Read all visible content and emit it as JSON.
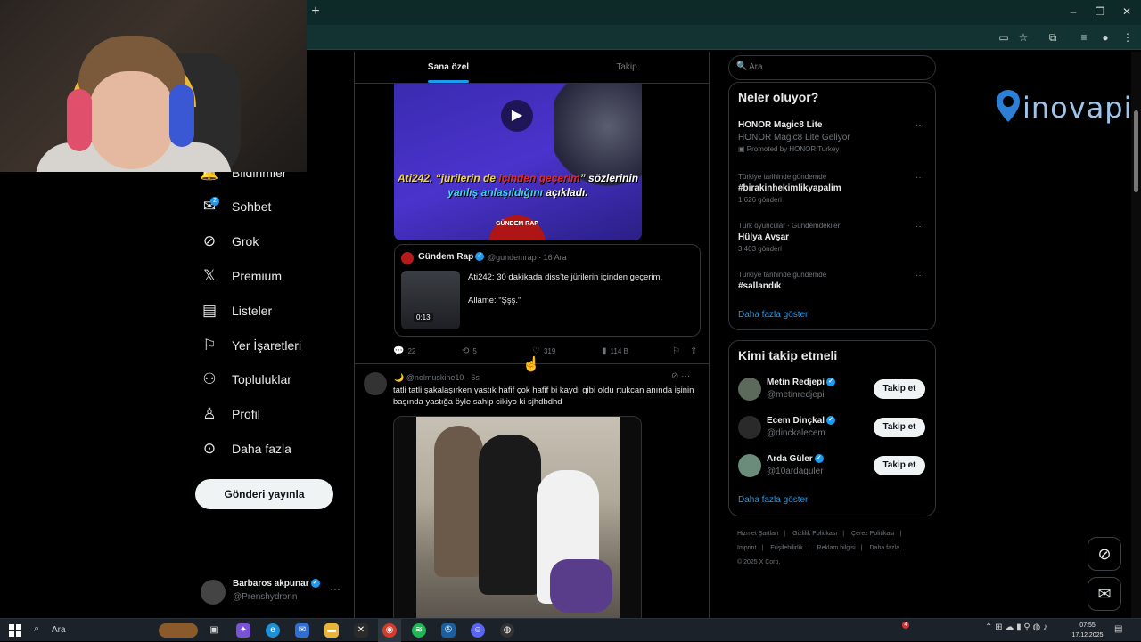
{
  "browser": {
    "new_tab_icon": "plus-icon",
    "window_controls": [
      "minimize",
      "restore",
      "close"
    ]
  },
  "nav": {
    "items": [
      {
        "label": "Bildirimler",
        "icon": "bell-icon"
      },
      {
        "label": "Sohbet",
        "icon": "chat-icon",
        "badge": "2"
      },
      {
        "label": "Grok",
        "icon": "grok-icon"
      },
      {
        "label": "Premium",
        "icon": "x-logo-icon"
      },
      {
        "label": "Listeler",
        "icon": "list-icon"
      },
      {
        "label": "Yer İşaretleri",
        "icon": "bookmark-icon"
      },
      {
        "label": "Topluluklar",
        "icon": "communities-icon"
      },
      {
        "label": "Profil",
        "icon": "profile-icon"
      },
      {
        "label": "Daha fazla",
        "icon": "more-circle-icon"
      }
    ],
    "post_button": "Gönderi yayınla",
    "account": {
      "name": "Barbaros akpunar",
      "handle": "@Prenshydronn"
    }
  },
  "feed": {
    "tabs": {
      "for_you": "Sana özel",
      "following": "Takip"
    },
    "post1": {
      "video_caption_1": "Ati242, “jürilerin de ",
      "video_caption_red": "içinden geçerim",
      "video_caption_2": "” sözlerinin",
      "video_caption_3a": "yanlış anlaşıldığını",
      "video_caption_3b": " açıkladı.",
      "video_logo": "GÜNDEM RAP",
      "quote": {
        "name": "Gündem Rap",
        "handle_date": "@gundemrap · 16 Ara",
        "text": "Ati242: 30 dakikada diss’te jürilerin içinden geçerim.",
        "text2": "Allame: “Şşş.”",
        "duration": "0:13"
      },
      "actions": {
        "replies": "22",
        "reposts": "5",
        "likes": "319",
        "views": "114 B"
      }
    },
    "post2": {
      "meta": "🌙 @nolmuskine10 · 6s",
      "text": "tatli tatli şakalaşırken yastık hafif çok hafif bi kaydı gibi oldu rtukcan anında işinin başında yastığa öyle sahip cikiyo ki sjhdbdhd"
    }
  },
  "sidebar": {
    "search_placeholder": "Ara",
    "trends": {
      "heading": "Neler oluyor?",
      "items": [
        {
          "title": "HONOR Magic8 Lite",
          "subtitle": "HONOR Magic8 Lite Geliyor",
          "count": "Promoted by HONOR Turkey"
        },
        {
          "context": "Türkiye tarihinde gündemde",
          "title": "#birakinhekimlikyapalim",
          "count": "1.626 gönderi"
        },
        {
          "context": "Türk oyuncular · Gündemdekiler",
          "title": "Hülya Avşar",
          "count": "3.403 gönderi"
        },
        {
          "context": "Türkiye tarihinde gündemde",
          "title": "#sallandık",
          "count": ""
        }
      ],
      "show_more": "Daha fazla göster"
    },
    "who_to_follow": {
      "heading": "Kimi takip etmeli",
      "users": [
        {
          "name": "Metin Redjepi",
          "handle": "@metinredjepi",
          "button": "Takip et"
        },
        {
          "name": "Ecem Dinçkal",
          "handle": "@dinckalecem",
          "button": "Takip et"
        },
        {
          "name": "Arda Güler",
          "handle": "@10ardaguler",
          "button": "Takip et"
        }
      ],
      "show_more": "Daha fazla göster"
    },
    "footer": {
      "links": [
        "Hizmet Şartları",
        "|",
        "Gizlilik Politikası",
        "|",
        "Çerez Politikası",
        "|",
        "Imprint",
        "|",
        "Erişilebilirlik",
        "|",
        "Reklam bilgisi",
        "|",
        "Daha fazla ..."
      ],
      "copyright": "© 2025 X Corp."
    }
  },
  "watermark": {
    "text": "inovapin"
  },
  "taskbar": {
    "search_placeholder": "Ara",
    "notification_count": "4",
    "time": "07:55",
    "date": "17.12.2025"
  },
  "colors": {
    "accent": "#1d9bf0",
    "browser_chrome": "#0e2a28",
    "taskbar": "#1c2229"
  }
}
